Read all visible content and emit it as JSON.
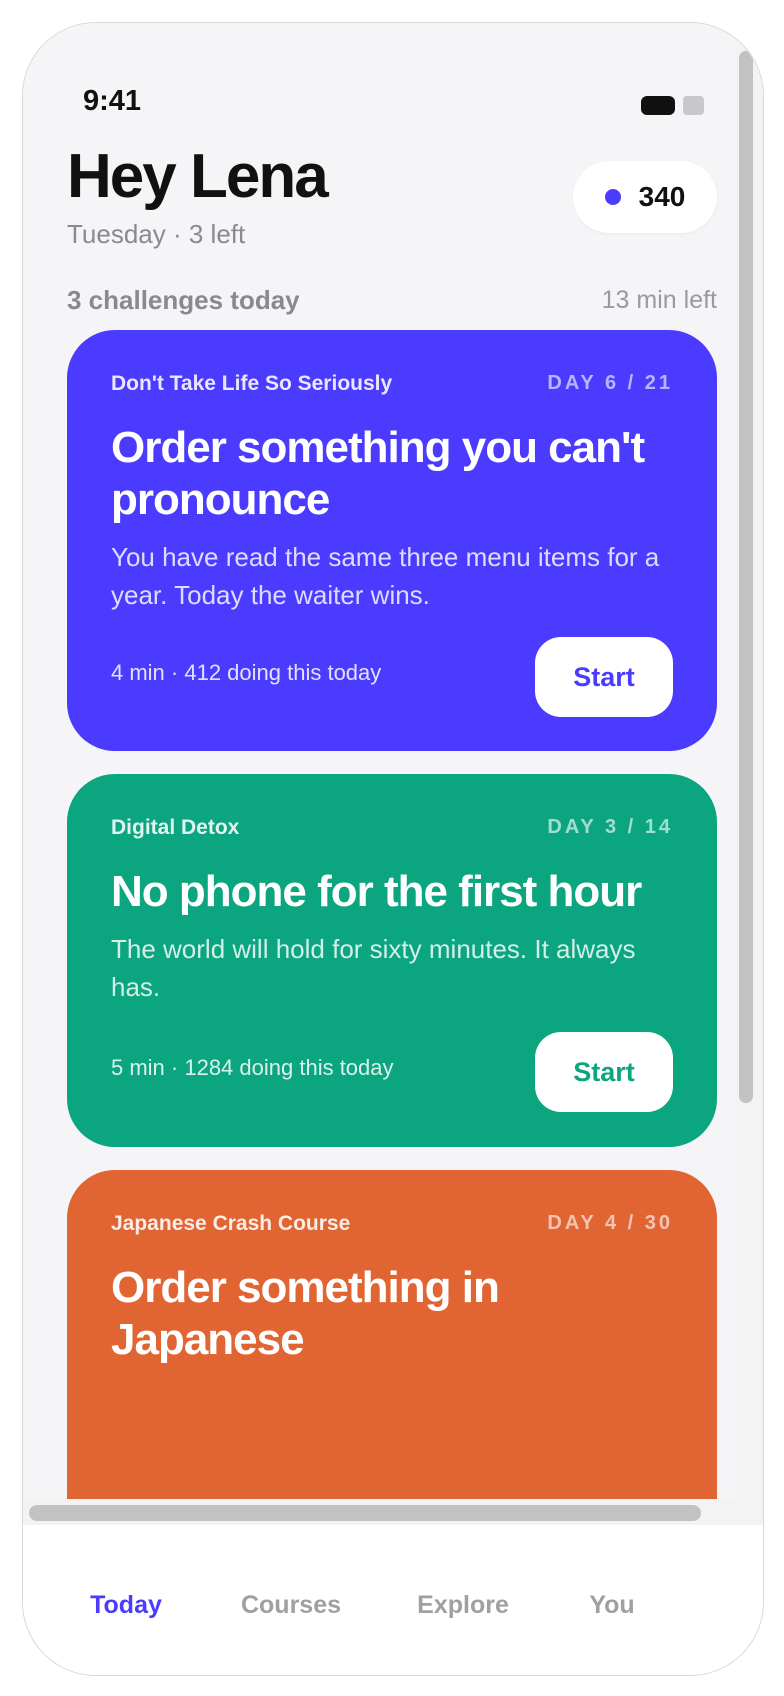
{
  "status_bar": {
    "time": "9:41"
  },
  "header": {
    "greeting": "Hey Lena",
    "subtitle": "Tuesday · 3 left",
    "points": "340",
    "points_dot_color": "#4a3bff"
  },
  "section": {
    "title": "3 challenges today",
    "time_left": "13 min left"
  },
  "challenges": [
    {
      "course": "Don't Take Life So Seriously",
      "day": "DAY 6 / 21",
      "title": "Order something you can't pronounce",
      "description": "You have read the same three menu items for a year. Today the waiter wins.",
      "meta": "4 min · 412 doing this today",
      "button": "Start",
      "color": "#4a3bff"
    },
    {
      "course": "Digital Detox",
      "day": "DAY 3 / 14",
      "title": "No phone for the first hour",
      "description": "The world will hold for sixty minutes. It always has.",
      "meta": "5 min · 1284 doing this today",
      "button": "Start",
      "color": "#0ba57f"
    },
    {
      "course": "Japanese Crash Course",
      "day": "DAY 4 / 30",
      "title": "Order something in Japanese",
      "color": "#e06532"
    }
  ],
  "tabs": [
    {
      "label": "Today",
      "active": true
    },
    {
      "label": "Courses",
      "active": false
    },
    {
      "label": "Explore",
      "active": false
    },
    {
      "label": "You",
      "active": false
    }
  ],
  "colors": {
    "accent": "#4a3bff",
    "background": "#f5f5f7"
  }
}
